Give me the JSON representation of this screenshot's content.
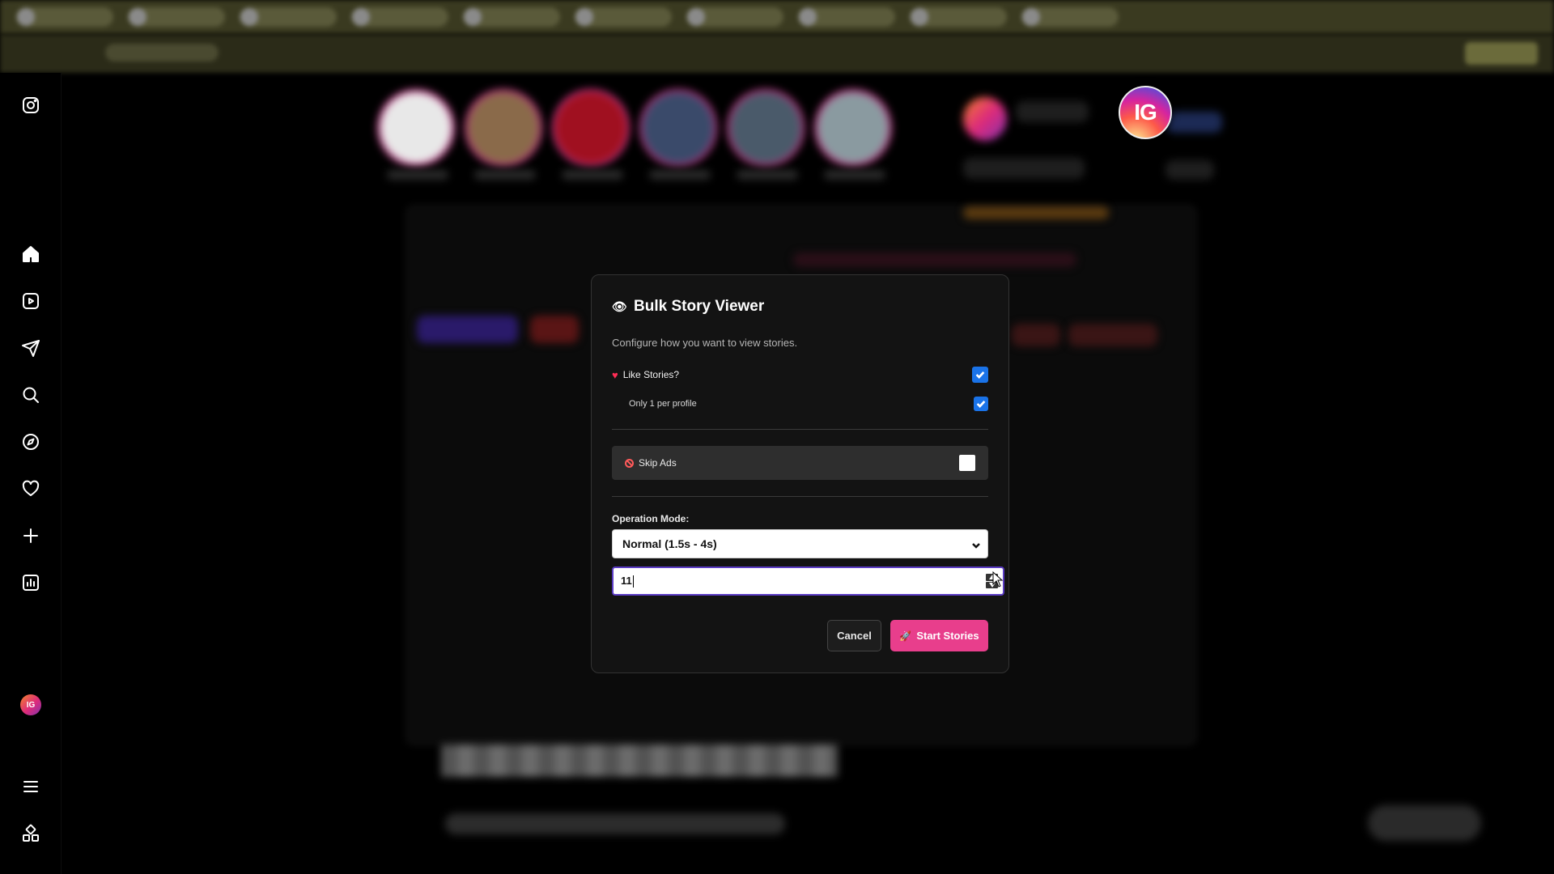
{
  "modal": {
    "icon": "eye-icon",
    "title": "Bulk Story Viewer",
    "subtitle": "Configure how you want to view stories.",
    "like_stories": {
      "label": "Like Stories?",
      "icon": "heart-icon",
      "checked": true
    },
    "only_one": {
      "label": "Only 1 per profile",
      "checked": true
    },
    "skip_ads": {
      "label": "Skip Ads",
      "icon": "no-entry-icon",
      "checked": false
    },
    "operation_mode": {
      "label": "Operation Mode:",
      "selected": "Normal (1.5s - 4s)"
    },
    "number_input": {
      "value": "11"
    },
    "cancel_label": "Cancel",
    "start_label": "Start Stories",
    "start_icon": "rocket-icon"
  },
  "profile_badge": {
    "text": "IG"
  },
  "sidebar": {
    "items": [
      {
        "icon": "instagram-logo-icon"
      },
      {
        "icon": "home-icon"
      },
      {
        "icon": "reels-icon"
      },
      {
        "icon": "send-icon"
      },
      {
        "icon": "search-icon"
      },
      {
        "icon": "explore-icon"
      },
      {
        "icon": "heart-icon"
      },
      {
        "icon": "plus-icon"
      },
      {
        "icon": "insights-icon"
      },
      {
        "icon": "profile-avatar"
      },
      {
        "icon": "menu-icon"
      },
      {
        "icon": "apps-icon"
      }
    ],
    "avatar_text": "IG"
  },
  "colors": {
    "accent_pink": "#e83e8c",
    "checkbox_blue": "#1a73e8",
    "input_focus": "#5b3cc4"
  }
}
